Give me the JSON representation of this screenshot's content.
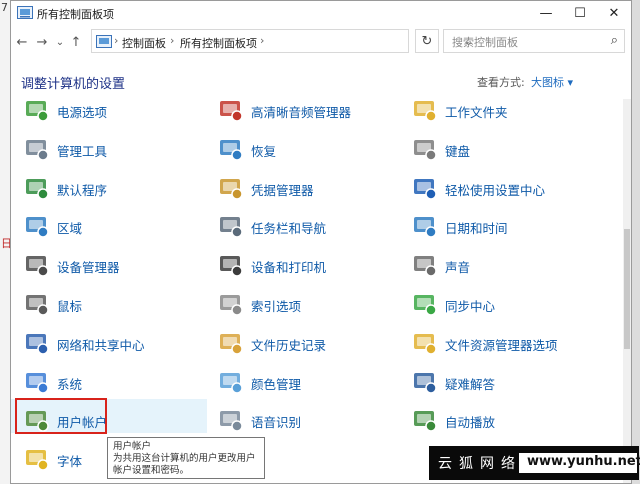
{
  "background": {
    "left_chars": [
      "7",
      "",
      "",
      "",
      "",
      "",
      "",
      "",
      "",
      "",
      "",
      "",
      "",
      "",
      "",
      "",
      "",
      "",
      "",
      "",
      "",
      "日",
      "",
      "",
      "",
      "",
      "",
      "",
      "",
      "",
      "",
      "",
      "",
      "",
      "",
      "",
      "",
      "",
      "",
      ""
    ]
  },
  "window": {
    "title": "所有控制面板项",
    "buttons": {
      "minimize": "—",
      "maximize": "☐",
      "close": "✕"
    }
  },
  "nav": {
    "back": "←",
    "forward": "→",
    "recent": "⌄",
    "up": "↑"
  },
  "address": {
    "crumbs": [
      "控制面板",
      "所有控制面板项"
    ],
    "separator": "›",
    "dropdown": "⌄",
    "refresh": "↻"
  },
  "search": {
    "placeholder": "搜索控制面板",
    "icon": "⌕"
  },
  "heading": "调整计算机的设置",
  "view": {
    "label": "查看方式:",
    "value": "大图标 ▾"
  },
  "columns": [
    [
      {
        "label": "电源选项",
        "icon": "power-options-icon",
        "color": "#3c9c3a"
      },
      {
        "label": "管理工具",
        "icon": "admin-tools-icon",
        "color": "#6b7b8c"
      },
      {
        "label": "默认程序",
        "icon": "default-programs-icon",
        "color": "#2e8b3d"
      },
      {
        "label": "区域",
        "icon": "region-icon",
        "color": "#2f7cc2"
      },
      {
        "label": "设备管理器",
        "icon": "device-manager-icon",
        "color": "#4a4a4a"
      },
      {
        "label": "鼠标",
        "icon": "mouse-icon",
        "color": "#5a5a5a"
      },
      {
        "label": "网络和共享中心",
        "icon": "network-icon",
        "color": "#2c5fae"
      },
      {
        "label": "系统",
        "icon": "system-icon",
        "color": "#3a7bd5"
      },
      {
        "label": "用户帐户",
        "icon": "user-accounts-icon",
        "color": "#4f8a3a"
      },
      {
        "label": "字体",
        "icon": "fonts-icon",
        "color": "#e1b422"
      }
    ],
    [
      {
        "label": "高清晰音频管理器",
        "icon": "audio-manager-icon",
        "color": "#c2352a"
      },
      {
        "label": "恢复",
        "icon": "recovery-icon",
        "color": "#2f7cc2"
      },
      {
        "label": "凭据管理器",
        "icon": "credential-manager-icon",
        "color": "#c9962e"
      },
      {
        "label": "任务栏和导航",
        "icon": "taskbar-icon",
        "color": "#5a6a7a"
      },
      {
        "label": "设备和打印机",
        "icon": "printer-icon",
        "color": "#3c3c3c"
      },
      {
        "label": "索引选项",
        "icon": "indexing-icon",
        "color": "#8a8a8a"
      },
      {
        "label": "文件历史记录",
        "icon": "file-history-icon",
        "color": "#d8a23a"
      },
      {
        "label": "颜色管理",
        "icon": "color-management-icon",
        "color": "#5aa0d8"
      },
      {
        "label": "语音识别",
        "icon": "speech-recognition-icon",
        "color": "#7a8a9a"
      }
    ],
    [
      {
        "label": "工作文件夹",
        "icon": "work-folders-icon",
        "color": "#e0b030"
      },
      {
        "label": "键盘",
        "icon": "keyboard-icon",
        "color": "#7a7a7a"
      },
      {
        "label": "轻松使用设置中心",
        "icon": "ease-of-access-icon",
        "color": "#1f5fb5"
      },
      {
        "label": "日期和时间",
        "icon": "date-time-icon",
        "color": "#2f7cc2"
      },
      {
        "label": "声音",
        "icon": "sound-icon",
        "color": "#6a6a6a"
      },
      {
        "label": "同步中心",
        "icon": "sync-center-icon",
        "color": "#3aa845"
      },
      {
        "label": "文件资源管理器选项",
        "icon": "folder-options-icon",
        "color": "#e0b030"
      },
      {
        "label": "疑难解答",
        "icon": "troubleshooting-icon",
        "color": "#2d5e9e"
      },
      {
        "label": "自动播放",
        "icon": "autoplay-icon",
        "color": "#3a8a3a"
      }
    ]
  ],
  "tooltip": {
    "title": "用户帐户",
    "description": "为共用这台计算机的用户更改用户帐户设置和密码。"
  },
  "watermark": {
    "cn": "云狐网络",
    "en": "www.yunhu.net"
  }
}
